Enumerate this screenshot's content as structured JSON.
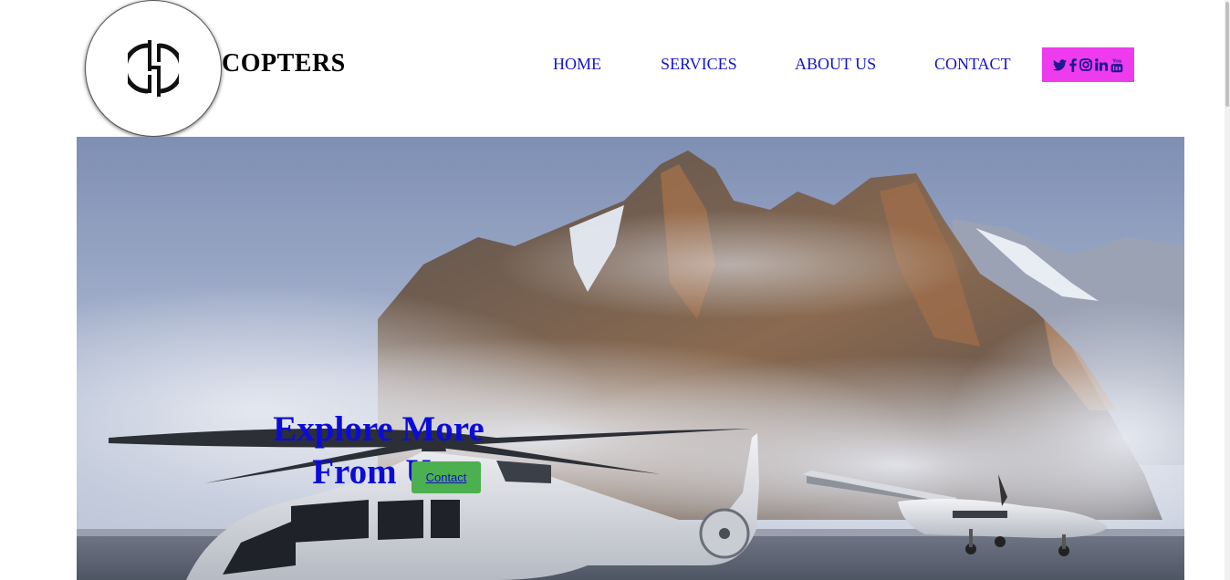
{
  "header": {
    "brand": "COPTERS",
    "logo_icon": "hc-monogram-icon"
  },
  "nav": {
    "items": [
      {
        "label": "HOME"
      },
      {
        "label": "SERVICES"
      },
      {
        "label": "ABOUT US"
      },
      {
        "label": "CONTACT"
      }
    ]
  },
  "social": {
    "background": "#ee3bee",
    "icons": [
      "twitter-icon",
      "facebook-icon",
      "instagram-icon",
      "linkedin-icon",
      "youtube-icon"
    ]
  },
  "hero": {
    "title_line1": "Explore More",
    "title_line2": "From Us",
    "button_label": "Contact",
    "title_color": "#0c0cd9",
    "button_color": "#4caf50"
  }
}
